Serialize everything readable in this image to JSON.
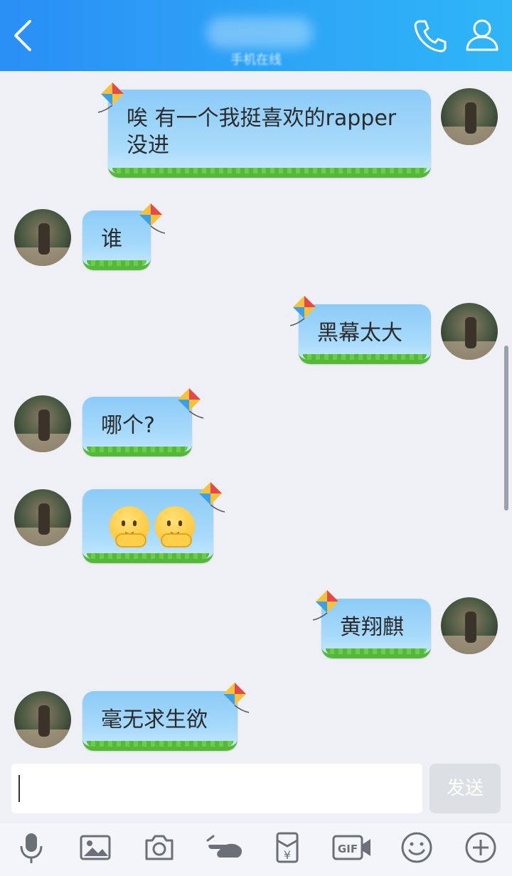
{
  "header": {
    "title": "",
    "subtitle": "手机在线",
    "icons": [
      "back-icon",
      "phone-icon",
      "profile-icon"
    ],
    "color_left": "#2a8ff6",
    "color_right": "#2fb6f7"
  },
  "messages": [
    {
      "side": "right",
      "text": "唉  有一个我挺喜欢的rapper\n没进"
    },
    {
      "side": "left",
      "text": "谁"
    },
    {
      "side": "right",
      "text": "黑幕太大"
    },
    {
      "side": "left",
      "text": "哪个?"
    },
    {
      "side": "left",
      "text": "",
      "emoji": [
        "pensive-face",
        "pensive-face"
      ]
    },
    {
      "side": "right",
      "text": "黄翔麒"
    },
    {
      "side": "left",
      "text": "毫无求生欲"
    }
  ],
  "input": {
    "value": "",
    "placeholder": ""
  },
  "send_label": "发送",
  "toolbar": [
    "microphone-icon",
    "image-icon",
    "camera-icon",
    "poke-icon",
    "red-packet-icon",
    "gif-icon",
    "emoji-icon",
    "plus-icon"
  ],
  "colors": {
    "bubble": "#a9dbfb",
    "grass": "#55b83a",
    "background": "#eef0f5"
  }
}
